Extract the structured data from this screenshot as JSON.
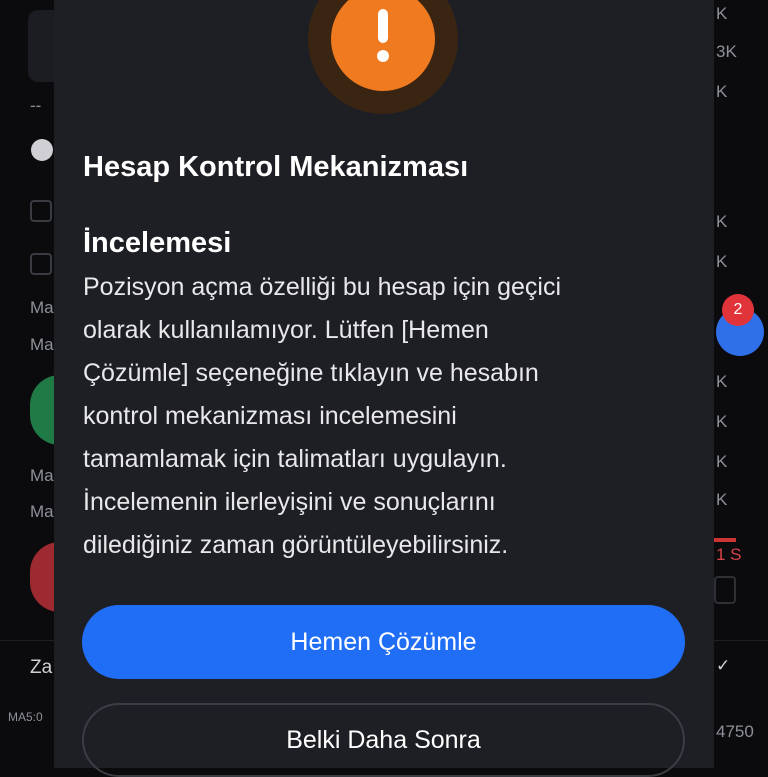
{
  "background": {
    "left_fragments": [
      "--",
      "Ma",
      "Ma",
      "Ma",
      "Ma",
      "Za",
      "MA5:0"
    ],
    "right_fragments": [
      "K",
      "3K",
      "K",
      "K",
      "K",
      "K",
      "K",
      "K",
      "K",
      "K",
      "1 S",
      "4750"
    ],
    "chat_badge_count": "2"
  },
  "dialog": {
    "icon": "warning-exclamation-icon",
    "accent_color": "#ef7a1f",
    "title_lines": [
      "Hesap Kontrol Mekanizması",
      "İncelemesi"
    ],
    "body_lines": [
      "Pozisyon açma özelliği bu hesap için geçici",
      "olarak kullanılamıyor. Lütfen [Hemen",
      "Çözümle] seçeneğine tıklayın ve hesabın",
      "kontrol mekanizması incelemesini",
      "tamamlamak için talimatları uygulayın.",
      "İncelemenin ilerleyişini ve sonuçlarını",
      "dilediğiniz zaman görüntüleyebilirsiniz."
    ],
    "primary_button": "Hemen Çözümle",
    "primary_color": "#1f6ef5",
    "secondary_button": "Belki Daha Sonra"
  }
}
